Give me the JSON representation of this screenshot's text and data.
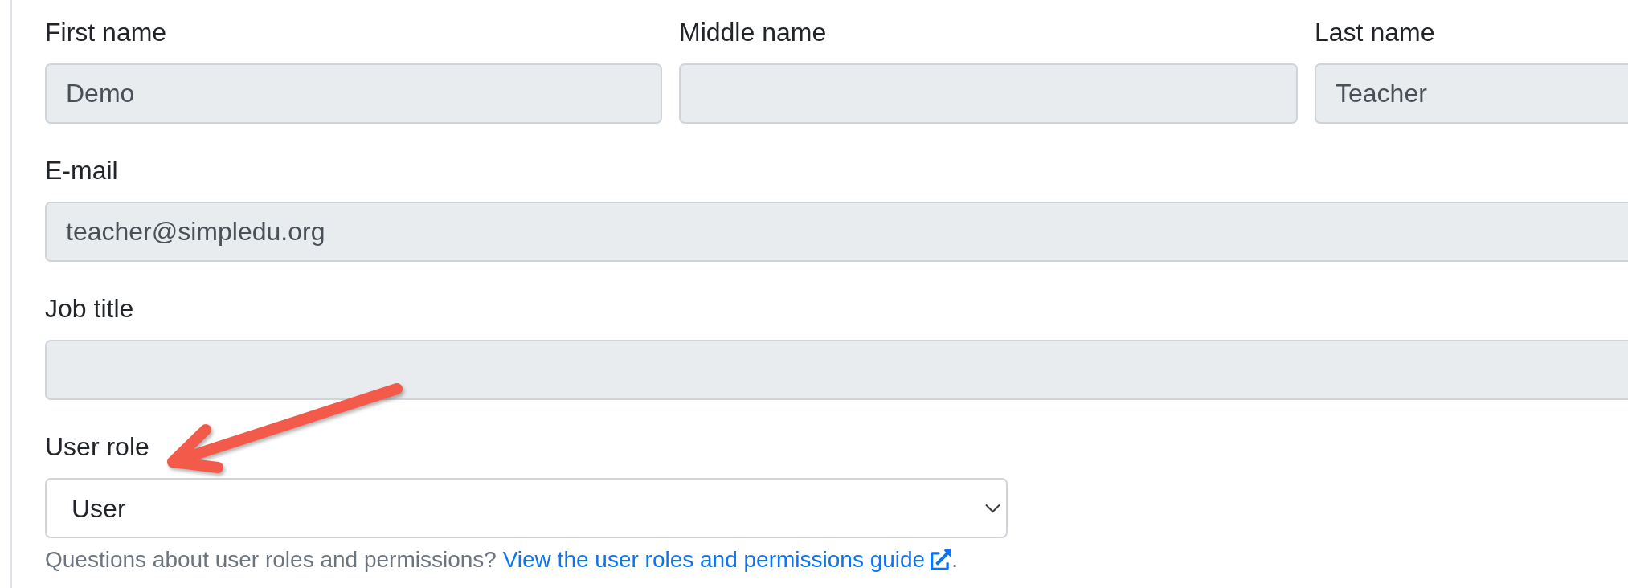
{
  "name_fields": [
    {
      "label": "First name",
      "value": "Demo",
      "disabled": true
    },
    {
      "label": "Middle name",
      "disabled": true
    },
    {
      "label": "Last name",
      "value": "Teacher",
      "disabled": true
    }
  ],
  "fields": [
    {
      "label": "E-mail",
      "value": "teacher@simpledu.org",
      "disabled": true
    },
    {
      "label": "Job title",
      "disabled": true
    }
  ],
  "user_role": {
    "label": "User role",
    "value": "User",
    "disabled": false
  },
  "help": {
    "text": "Questions about user roles and permissions?",
    "link": "View the user roles and permissions guide",
    "suffix": "."
  }
}
